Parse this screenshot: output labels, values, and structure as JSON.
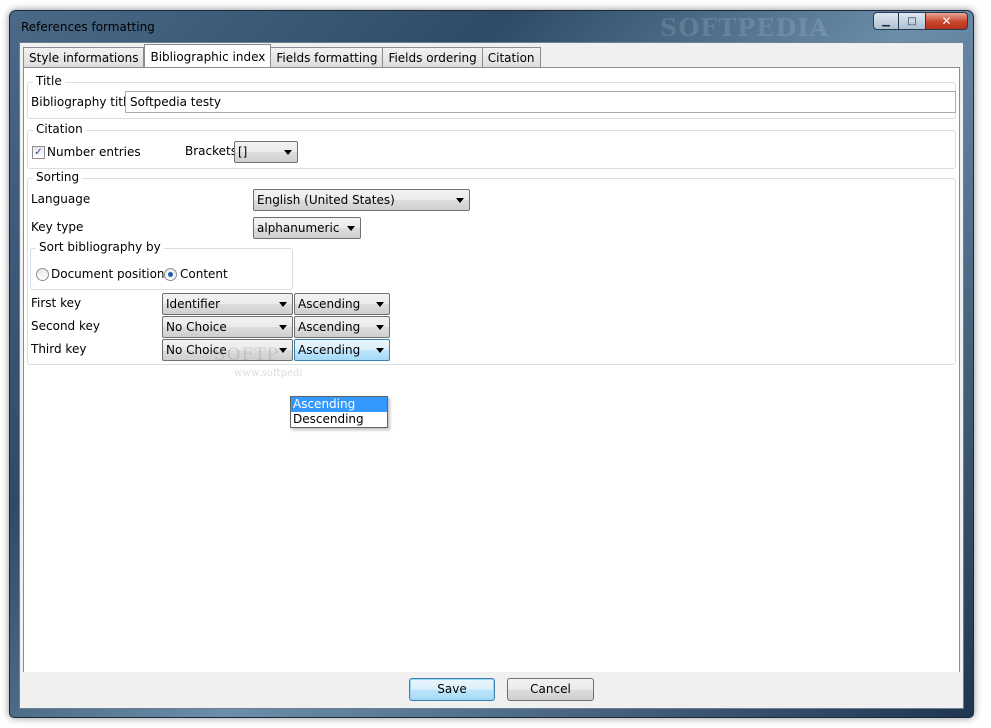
{
  "window": {
    "title": "References formatting",
    "watermark": "SOFTPEDIA",
    "caption": {
      "minimize": "▁",
      "maximize": "□",
      "close": "✕"
    }
  },
  "tabs": [
    {
      "label": "Style informations"
    },
    {
      "label": "Bibliographic index",
      "active": true
    },
    {
      "label": "Fields formatting"
    },
    {
      "label": "Fields ordering"
    },
    {
      "label": "Citation"
    }
  ],
  "title_group": {
    "legend": "Title",
    "bibliography_title_label": "Bibliography title",
    "bibliography_title_value": "Softpedia testy"
  },
  "citation_group": {
    "legend": "Citation",
    "number_entries_label": "Number entries",
    "number_entries_checked": true,
    "brackets_label": "Brackets",
    "brackets_value": "[]"
  },
  "sorting_group": {
    "legend": "Sorting",
    "language_label": "Language",
    "language_value": "English (United States)",
    "key_type_label": "Key type",
    "key_type_value": "alphanumeric",
    "sort_by": {
      "legend": "Sort bibliography by",
      "document_position_label": "Document position",
      "content_label": "Content",
      "selected": "content"
    },
    "keys": [
      {
        "label": "First key",
        "field": "Identifier",
        "order": "Ascending"
      },
      {
        "label": "Second key",
        "field": "No Choice",
        "order": "Ascending"
      },
      {
        "label": "Third key",
        "field": "No Choice",
        "order": "Ascending"
      }
    ]
  },
  "order_dropdown": {
    "options": [
      "Ascending",
      "Descending"
    ],
    "highlighted": "Ascending"
  },
  "watermark_overlay": {
    "logo": "SOFTP",
    "url": "www.softpedi"
  },
  "buttons": {
    "save": "Save",
    "cancel": "Cancel"
  }
}
